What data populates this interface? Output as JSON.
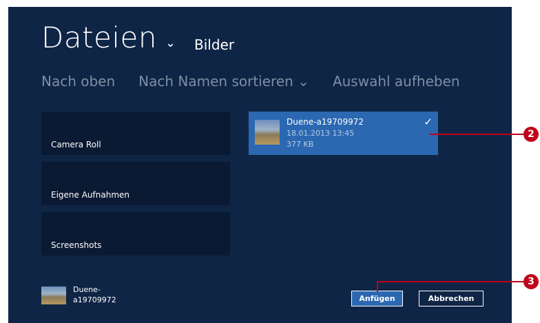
{
  "header": {
    "title": "Dateien",
    "chevron": "⌄",
    "location": "Bilder"
  },
  "commands": {
    "up": "Nach oben",
    "sort": "Nach Namen sortieren",
    "sort_chevron": "⌄",
    "clear": "Auswahl aufheben"
  },
  "folders": [
    {
      "label": "Camera Roll"
    },
    {
      "label": "Eigene Aufnahmen"
    },
    {
      "label": "Screenshots"
    }
  ],
  "file": {
    "name": "Duene-a19709972",
    "date": "18.01.2013 13:45",
    "size": "377 KB",
    "check": "✓"
  },
  "basket": {
    "name": "Duene-\na19709972"
  },
  "buttons": {
    "attach": "Anfügen",
    "cancel": "Abbrechen"
  },
  "callouts": {
    "two": "2",
    "three": "3",
    "color": "#c0001a"
  }
}
